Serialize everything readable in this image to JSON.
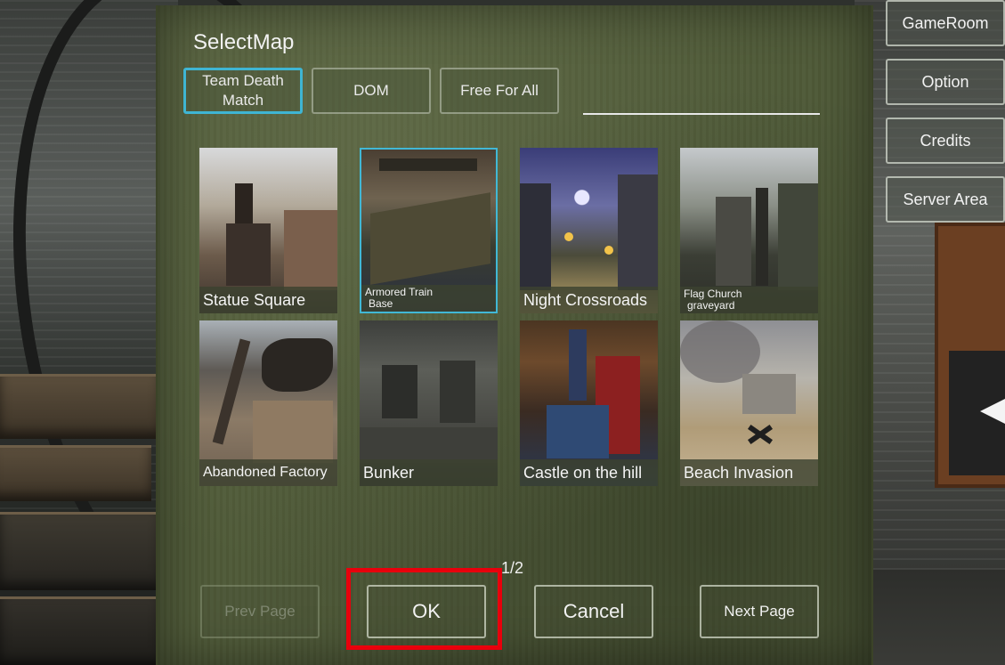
{
  "panel": {
    "title": "SelectMap",
    "tabs": [
      {
        "label": "Team Death Match",
        "active": true
      },
      {
        "label": "DOM",
        "active": false
      },
      {
        "label": "Free For All",
        "active": false
      }
    ],
    "search_value": ""
  },
  "maps": [
    {
      "name": "Statue Square",
      "selected": false
    },
    {
      "name_line1": "Armored Train",
      "name_line2": "Base",
      "selected": true
    },
    {
      "name": "Night Crossroads",
      "selected": false
    },
    {
      "name_line1": "Flag Church",
      "name_line2": "graveyard",
      "selected": false
    },
    {
      "name": "Abandoned Factory",
      "selected": false
    },
    {
      "name": "Bunker",
      "selected": false
    },
    {
      "name": "Castle on the hill",
      "selected": false
    },
    {
      "name": "Beach Invasion",
      "selected": false
    }
  ],
  "pagination": {
    "indicator": "1/2",
    "prev_label": "Prev Page",
    "next_label": "Next Page"
  },
  "actions": {
    "ok_label": "OK",
    "cancel_label": "Cancel"
  },
  "side_menu": [
    {
      "label": "GameRoom"
    },
    {
      "label": "Option"
    },
    {
      "label": "Credits"
    },
    {
      "label": "Server Area"
    }
  ],
  "colors": {
    "panel": "#4f5a38",
    "active_border": "#3fb5d3",
    "highlight": "#e8000c"
  }
}
